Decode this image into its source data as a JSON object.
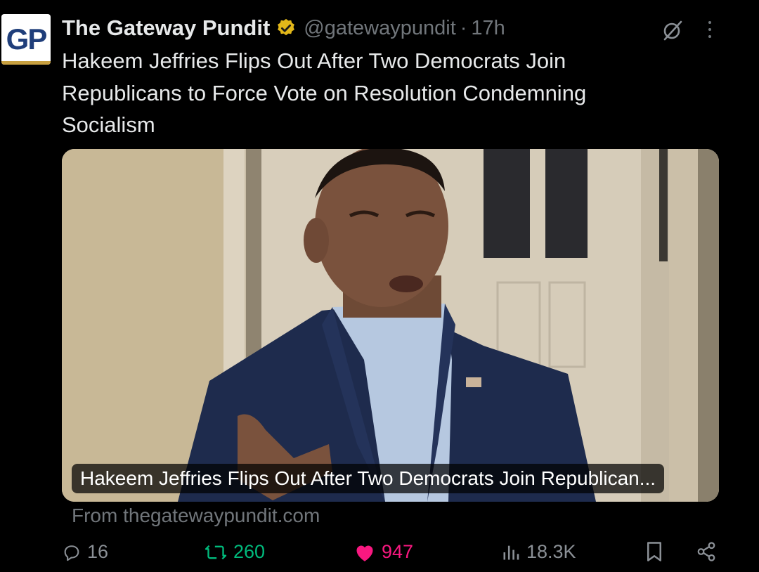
{
  "author": {
    "avatar_text": "GP",
    "display_name": "The Gateway Pundit",
    "handle": "@gatewaypundit",
    "separator": "·",
    "time": "17h"
  },
  "tweet": {
    "text": "Hakeem Jeffries Flips Out After Two Democrats Join Republicans to Force Vote on Resolution Condemning Socialism"
  },
  "card": {
    "caption": "Hakeem Jeffries Flips Out After Two Democrats Join Republican...",
    "source": "From thegatewaypundit.com"
  },
  "actions": {
    "replies": "16",
    "reposts": "260",
    "likes": "947",
    "views": "18.3K"
  },
  "icons": {
    "verified": "verified-badge-icon",
    "grok": "grok-icon",
    "more": "more-options-icon",
    "reply": "reply-icon",
    "repost": "repost-icon",
    "like": "heart-icon",
    "views": "views-chart-icon",
    "bookmark": "bookmark-icon",
    "share": "share-icon"
  },
  "colors": {
    "background": "#000000",
    "text": "#e7e9ea",
    "muted": "#71767b",
    "repost_active": "#00ba7c",
    "like_active": "#f91880",
    "verified_gold": "#e2b719"
  }
}
